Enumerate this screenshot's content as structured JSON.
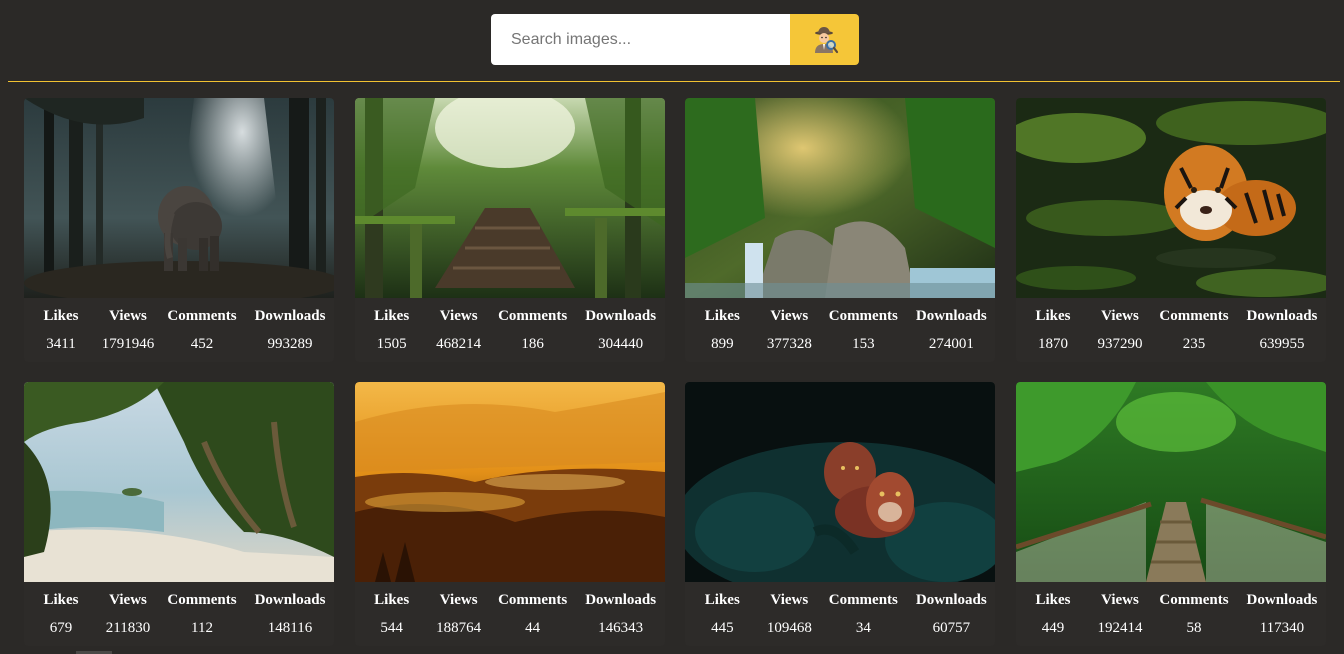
{
  "search": {
    "placeholder": "Search images...",
    "button_icon": "detective-search-icon"
  },
  "colors": {
    "background": "#2b2927",
    "accent": "#f5c638",
    "divider": "#f2c232",
    "text": "#ffffff"
  },
  "stat_labels": {
    "likes": "Likes",
    "views": "Views",
    "comments": "Comments",
    "downloads": "Downloads"
  },
  "cards": [
    {
      "subject": "elephant in misty forest",
      "likes": "3411",
      "views": "1791946",
      "comments": "452",
      "downloads": "993289"
    },
    {
      "subject": "wooden forest path",
      "likes": "1505",
      "views": "468214",
      "comments": "186",
      "downloads": "304440"
    },
    {
      "subject": "jungle waterfall",
      "likes": "899",
      "views": "377328",
      "comments": "153",
      "downloads": "274001"
    },
    {
      "subject": "tiger in water",
      "likes": "1870",
      "views": "937290",
      "comments": "235",
      "downloads": "639955"
    },
    {
      "subject": "tropical beach",
      "likes": "679",
      "views": "211830",
      "comments": "112",
      "downloads": "148116"
    },
    {
      "subject": "golden foggy forest",
      "likes": "544",
      "views": "188764",
      "comments": "44",
      "downloads": "146343"
    },
    {
      "subject": "lionesses in foliage",
      "likes": "445",
      "views": "109468",
      "comments": "34",
      "downloads": "60757"
    },
    {
      "subject": "jungle rope bridge",
      "likes": "449",
      "views": "192414",
      "comments": "58",
      "downloads": "117340"
    }
  ]
}
